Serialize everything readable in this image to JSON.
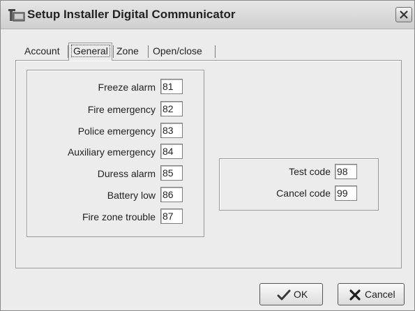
{
  "window": {
    "title": "Setup Installer Digital Communicator"
  },
  "tabs": [
    {
      "label": "Account",
      "selected": false
    },
    {
      "label": "General",
      "selected": true
    },
    {
      "label": "Zone",
      "selected": false
    },
    {
      "label": "Open/close",
      "selected": false
    }
  ],
  "event_codes": [
    {
      "label": "Freeze alarm",
      "value": "81"
    },
    {
      "label": "Fire emergency",
      "value": "82"
    },
    {
      "label": "Police emergency",
      "value": "83"
    },
    {
      "label": "Auxiliary emergency",
      "value": "84"
    },
    {
      "label": "Duress alarm",
      "value": "85"
    },
    {
      "label": "Battery low",
      "value": "86"
    },
    {
      "label": "Fire zone trouble",
      "value": "87"
    }
  ],
  "test_codes": [
    {
      "label": "Test code",
      "value": "98"
    },
    {
      "label": "Cancel code",
      "value": "99"
    }
  ],
  "buttons": {
    "ok": "OK",
    "cancel": "Cancel"
  },
  "icons": {
    "app": "installer-app-icon",
    "close": "close-icon",
    "ok": "checkmark-icon",
    "cancel": "x-mark-icon"
  },
  "colors": {
    "checkmark": "#3a3a3a",
    "xmark": "#1f1f1f"
  }
}
